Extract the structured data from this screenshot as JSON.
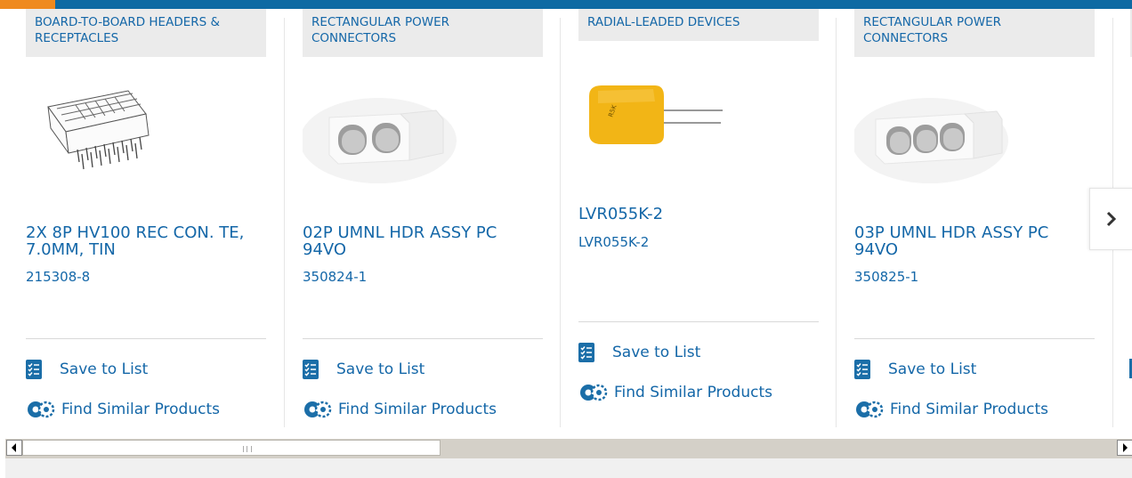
{
  "cards": [
    {
      "category": "BOARD-TO-BOARD HEADERS & RECEPTACLES",
      "title": "2X 8P HV100 REC CON. TE, 7.0MM, TIN",
      "part_number": "215308-8",
      "save_label": "Save to List",
      "similar_label": "Find Similar Products",
      "image": "board-to-board-receptacle-image"
    },
    {
      "category": "RECTANGULAR POWER CONNECTORS",
      "title": "02P UMNL HDR ASSY PC 94VO",
      "part_number": "350824-1",
      "save_label": "Save to List",
      "similar_label": "Find Similar Products",
      "image": "two-pin-connector-image"
    },
    {
      "category": "RADIAL-LEADED DEVICES",
      "title": "LVR055K-2",
      "part_number": "LVR055K-2",
      "save_label": "Save to List",
      "similar_label": "Find Similar Products",
      "image": "radial-leaded-device-image"
    },
    {
      "category": "RECTANGULAR POWER CONNECTORS",
      "title": "03P UMNL HDR ASSY PC 94VO",
      "part_number": "350825-1",
      "save_label": "Save to List",
      "similar_label": "Find Similar Products",
      "image": "three-pin-connector-image"
    }
  ],
  "navigation": {
    "next_icon": "chevron-right-icon"
  },
  "icons": {
    "save": "checklist-icon",
    "similar": "gears-icon"
  },
  "colors": {
    "brand_blue": "#1467a8",
    "top_bar": "#0e6aa3",
    "accent_orange": "#ef8a1f",
    "category_bg": "#ebebeb"
  }
}
